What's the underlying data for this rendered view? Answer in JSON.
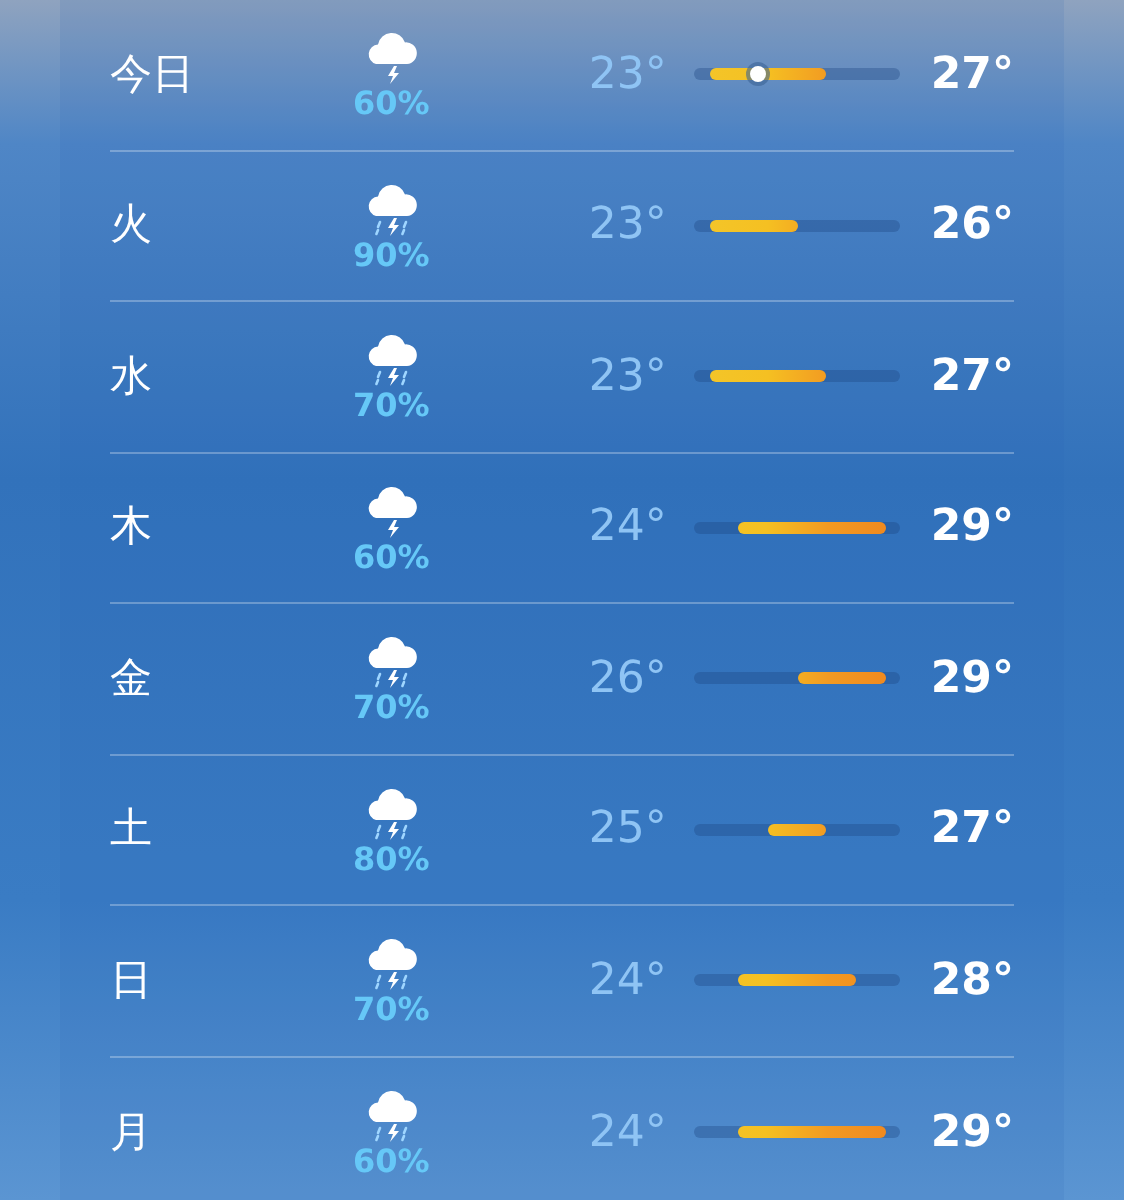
{
  "days": [
    {
      "day": "今日",
      "kind": "thunder",
      "precip": "60%",
      "low": "23°",
      "high": "27°",
      "current": {
        "level": 0.31
      }
    },
    {
      "day": "火",
      "kind": "storm",
      "precip": "90%",
      "low": "23°",
      "high": "26°"
    },
    {
      "day": "水",
      "kind": "storm",
      "precip": "70%",
      "low": "23°",
      "high": "27°"
    },
    {
      "day": "木",
      "kind": "thunder",
      "precip": "60%",
      "low": "24°",
      "high": "29°"
    },
    {
      "day": "金",
      "kind": "storm",
      "precip": "70%",
      "low": "26°",
      "high": "29°"
    },
    {
      "day": "土",
      "kind": "storm",
      "precip": "80%",
      "low": "25°",
      "high": "27°"
    },
    {
      "day": "日",
      "kind": "storm",
      "precip": "70%",
      "low": "24°",
      "high": "28°"
    },
    {
      "day": "月",
      "kind": "storm",
      "precip": "60%",
      "low": "24°",
      "high": "29°"
    }
  ]
}
